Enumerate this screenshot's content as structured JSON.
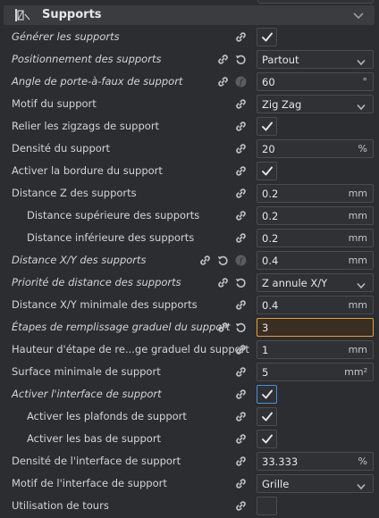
{
  "section": {
    "title": "Supports",
    "icon": "support-structure-icon"
  },
  "rows": [
    {
      "label": "Générer les supports",
      "italic": true,
      "indent": 1,
      "icons": [
        "link"
      ],
      "control": "checkbox",
      "checked": true
    },
    {
      "label": "Positionnement des supports",
      "italic": true,
      "indent": 1,
      "icons": [
        "link",
        "undo"
      ],
      "control": "dropdown",
      "value": "Partout"
    },
    {
      "label": "Angle de porte-à-faux de support",
      "italic": true,
      "indent": 1,
      "icons": [
        "link",
        "function"
      ],
      "control": "number",
      "value": "60",
      "unit": "°"
    },
    {
      "label": "Motif du support",
      "italic": false,
      "indent": 1,
      "icons": [
        "link"
      ],
      "control": "dropdown",
      "value": "Zig Zag"
    },
    {
      "label": "Relier les zigzags de support",
      "italic": false,
      "indent": 1,
      "icons": [
        "link"
      ],
      "control": "checkbox",
      "checked": true
    },
    {
      "label": "Densité du support",
      "italic": false,
      "indent": 1,
      "icons": [
        "link"
      ],
      "control": "number",
      "value": "20",
      "unit": "%"
    },
    {
      "label": "Activer la bordure du support",
      "italic": false,
      "indent": 1,
      "icons": [
        "link"
      ],
      "control": "checkbox",
      "checked": true
    },
    {
      "label": "Distance Z des supports",
      "italic": false,
      "indent": 1,
      "icons": [
        "link"
      ],
      "control": "number",
      "value": "0.2",
      "unit": "mm"
    },
    {
      "label": "Distance supérieure des supports",
      "italic": false,
      "indent": 2,
      "icons": [
        "link"
      ],
      "control": "number",
      "value": "0.2",
      "unit": "mm"
    },
    {
      "label": "Distance inférieure des supports",
      "italic": false,
      "indent": 2,
      "icons": [
        "link"
      ],
      "control": "number",
      "value": "0.2",
      "unit": "mm"
    },
    {
      "label": "Distance X/Y des supports",
      "italic": true,
      "indent": 1,
      "icons": [
        "link",
        "undo",
        "function"
      ],
      "control": "number",
      "value": "0.4",
      "unit": "mm"
    },
    {
      "label": "Priorité de distance des supports",
      "italic": true,
      "indent": 1,
      "icons": [
        "link",
        "undo"
      ],
      "control": "dropdown",
      "value": "Z annule X/Y"
    },
    {
      "label": "Distance X/Y minimale des supports",
      "italic": false,
      "indent": 1,
      "icons": [
        "link"
      ],
      "control": "number",
      "value": "0.4",
      "unit": "mm"
    },
    {
      "label": "Étapes de remplissage graduel du support",
      "italic": true,
      "indent": 1,
      "icons": [
        "link",
        "undo"
      ],
      "control": "number",
      "value": "3",
      "unit": "",
      "active": true
    },
    {
      "label": "Hauteur d'étape de re...ge graduel du support",
      "italic": false,
      "indent": 1,
      "icons": [
        "link"
      ],
      "control": "number",
      "value": "1",
      "unit": "mm"
    },
    {
      "label": "Surface minimale de support",
      "italic": false,
      "indent": 1,
      "icons": [
        "link"
      ],
      "control": "number",
      "value": "5",
      "unit": "mm²"
    },
    {
      "label": "Activer l'interface de support",
      "italic": true,
      "indent": 1,
      "icons": [
        "link"
      ],
      "control": "checkbox",
      "checked": true,
      "focused": true
    },
    {
      "label": "Activer les plafonds de support",
      "italic": false,
      "indent": 2,
      "icons": [
        "link"
      ],
      "control": "checkbox",
      "checked": true
    },
    {
      "label": "Activer les bas de support",
      "italic": false,
      "indent": 2,
      "icons": [
        "link"
      ],
      "control": "checkbox",
      "checked": true
    },
    {
      "label": "Densité de l'interface de support",
      "italic": false,
      "indent": 1,
      "icons": [
        "link"
      ],
      "control": "number",
      "value": "33.333",
      "unit": "%"
    },
    {
      "label": "Motif de l'interface de support",
      "italic": false,
      "indent": 1,
      "icons": [
        "link"
      ],
      "control": "dropdown",
      "value": "Grille"
    },
    {
      "label": "Utilisation de tours",
      "italic": false,
      "indent": 1,
      "icons": [
        "link"
      ],
      "control": "checkbox",
      "checked": false
    }
  ],
  "colors": {
    "background": "#2b2d30",
    "field": "#2f3134",
    "border": "#4a4c50",
    "active_border": "#e0a040",
    "focus_border": "#4a8fd8"
  }
}
